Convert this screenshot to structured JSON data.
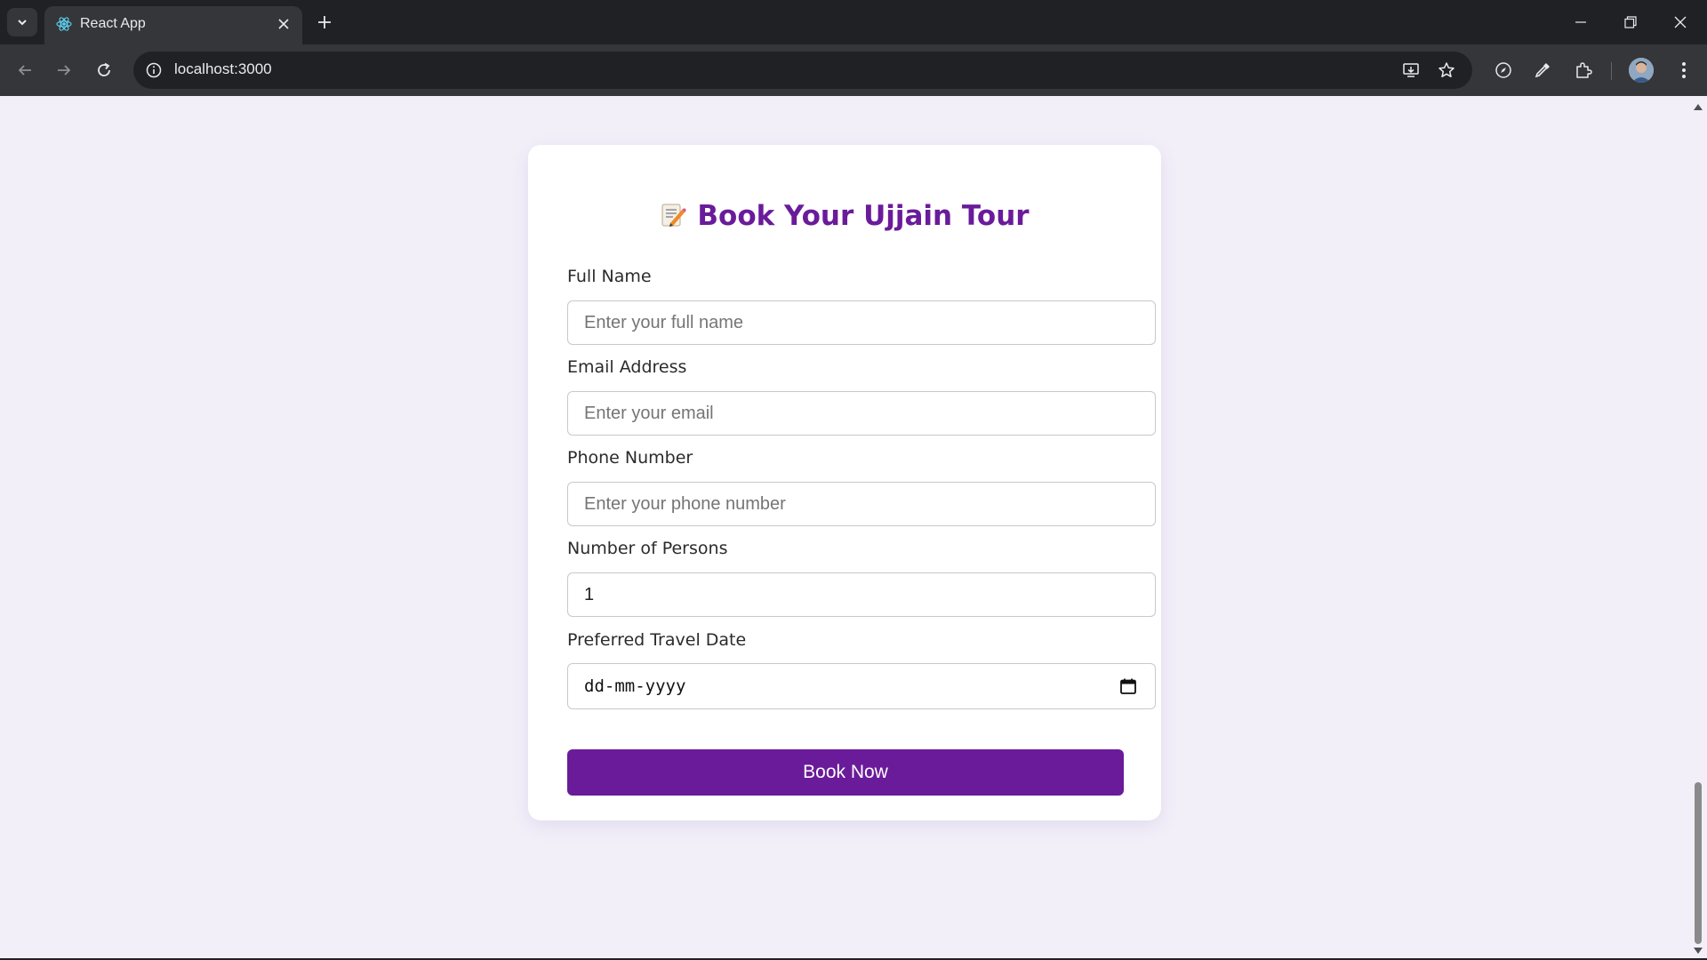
{
  "browser": {
    "tab_title": "React App",
    "url": "localhost:3000",
    "icons": [
      "tab-search-icon",
      "react-favicon-icon",
      "close-icon",
      "plus-icon",
      "minimize-icon",
      "restore-icon",
      "close-window-icon",
      "back-arrow-icon",
      "forward-arrow-icon",
      "reload-icon",
      "info-icon",
      "install-app-icon",
      "star-icon",
      "compass-icon",
      "eyedropper-icon",
      "puzzle-icon",
      "kebab-menu-icon"
    ]
  },
  "form": {
    "title": "Book Your Ujjain Tour",
    "title_icon": "memo-icon",
    "accent_color": "#6a1b9a",
    "background_color": "#f2eff9",
    "fields": {
      "full_name": {
        "label": "Full Name",
        "placeholder": "Enter your full name",
        "value": ""
      },
      "email": {
        "label": "Email Address",
        "placeholder": "Enter your email",
        "value": ""
      },
      "phone": {
        "label": "Phone Number",
        "placeholder": "Enter your phone number",
        "value": ""
      },
      "persons": {
        "label": "Number of Persons",
        "value": "1"
      },
      "travel_date": {
        "label": "Preferred Travel Date",
        "placeholder": "dd-mm-yyyy"
      }
    },
    "submit_label": "Book Now"
  }
}
